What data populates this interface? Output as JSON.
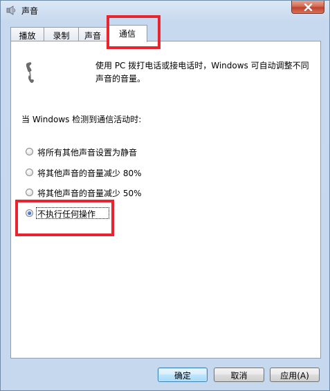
{
  "window": {
    "title": "声音"
  },
  "tabs": [
    {
      "label": "播放",
      "active": false
    },
    {
      "label": "录制",
      "active": false
    },
    {
      "label": "声音",
      "active": false
    },
    {
      "label": "通信",
      "active": true
    }
  ],
  "communications": {
    "description": "使用 PC 拨打电话或接电话时，Windows 可自动调整不同声音的音量。",
    "heading": "当 Windows 检测到通信活动时:",
    "options": [
      {
        "label": "将所有其他声音设置为静音",
        "selected": false
      },
      {
        "label": "将其他声音的音量减少 80%",
        "selected": false
      },
      {
        "label": "将其他声音的音量减少 50%",
        "selected": false
      },
      {
        "label": "不执行任何操作",
        "selected": true
      }
    ]
  },
  "buttons": {
    "ok": "确定",
    "cancel": "取消",
    "apply": "应用(A)"
  },
  "colors": {
    "highlight": "#e8242f",
    "selected_radio": "#1f4fa8",
    "close_button": "#c0422a"
  },
  "icons": {
    "title": "speaker-icon",
    "phone": "telephone-handset-icon",
    "close": "close-icon"
  }
}
